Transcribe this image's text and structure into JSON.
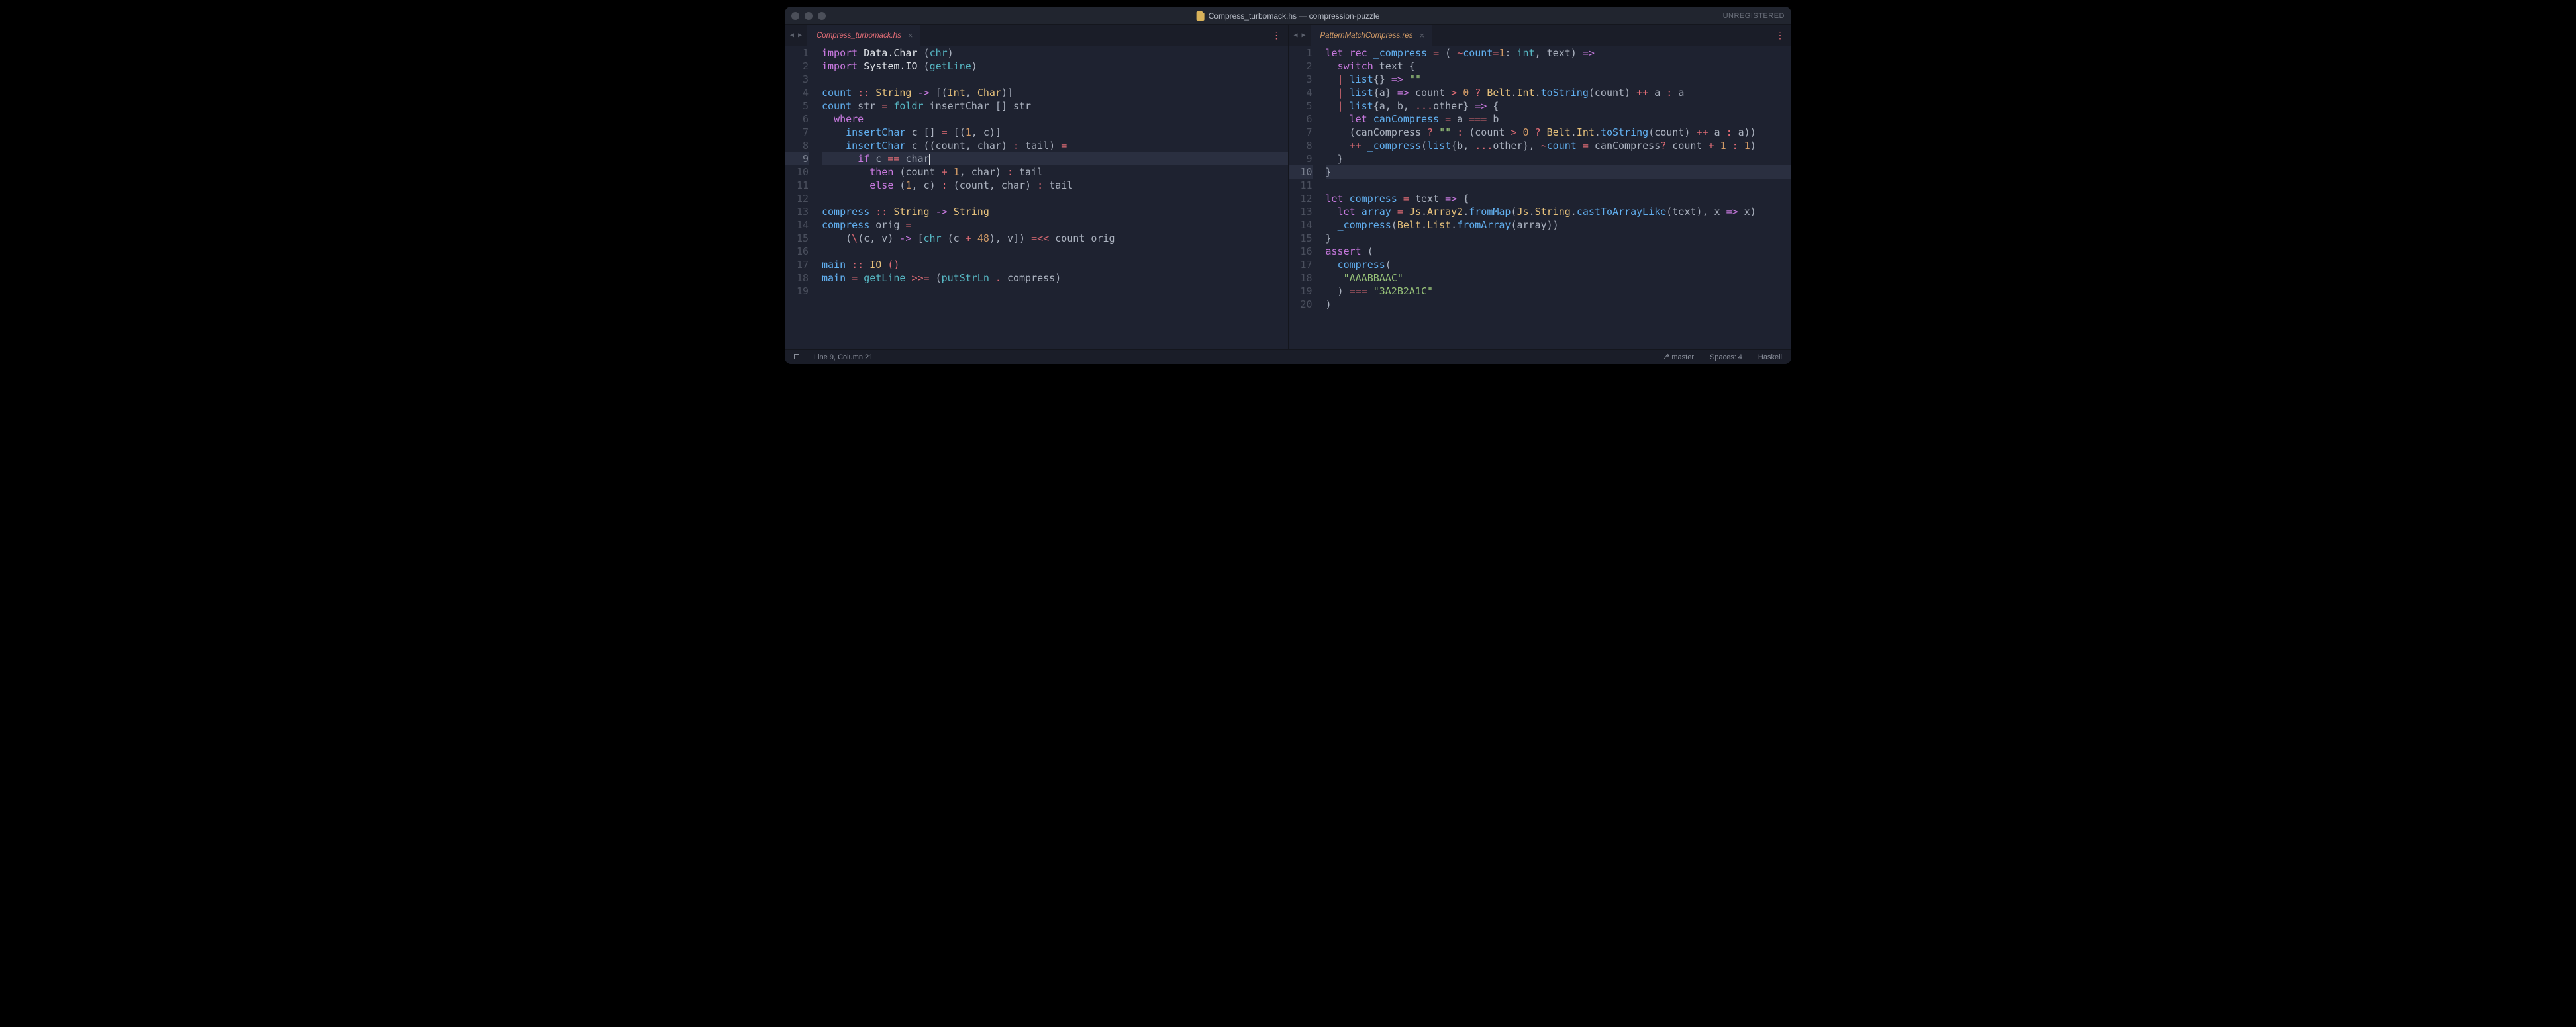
{
  "title": "Compress_turbomack.hs — compression-puzzle",
  "unregistered": "UNREGISTERED",
  "status": {
    "cursor": "Line 9, Column 21",
    "branch": "master",
    "spaces": "Spaces: 4",
    "syntax": "Haskell"
  },
  "left": {
    "tab": "Compress_turbomack.hs",
    "highlight_line": 9,
    "lines": [
      [
        {
          "c": "kw",
          "t": "import"
        },
        {
          "c": "pn",
          "t": " "
        },
        {
          "c": "wht",
          "t": "Data.Char"
        },
        {
          "c": "pn",
          "t": " ("
        },
        {
          "c": "ty",
          "t": "chr"
        },
        {
          "c": "pn",
          "t": ")"
        }
      ],
      [
        {
          "c": "kw",
          "t": "import"
        },
        {
          "c": "pn",
          "t": " "
        },
        {
          "c": "wht",
          "t": "System.IO"
        },
        {
          "c": "pn",
          "t": " ("
        },
        {
          "c": "ty",
          "t": "getLine"
        },
        {
          "c": "pn",
          "t": ")"
        }
      ],
      [],
      [
        {
          "c": "fn",
          "t": "count"
        },
        {
          "c": "pn",
          "t": " "
        },
        {
          "c": "red",
          "t": "::"
        },
        {
          "c": "pn",
          "t": " "
        },
        {
          "c": "id",
          "t": "String"
        },
        {
          "c": "pn",
          "t": " "
        },
        {
          "c": "kw",
          "t": "->"
        },
        {
          "c": "pn",
          "t": " ["
        },
        {
          "c": "pn",
          "t": "("
        },
        {
          "c": "id",
          "t": "Int"
        },
        {
          "c": "pn",
          "t": ", "
        },
        {
          "c": "id",
          "t": "Char"
        },
        {
          "c": "pn",
          "t": ")]"
        }
      ],
      [
        {
          "c": "fn",
          "t": "count"
        },
        {
          "c": "pn",
          "t": " str "
        },
        {
          "c": "red",
          "t": "="
        },
        {
          "c": "pn",
          "t": " "
        },
        {
          "c": "ty",
          "t": "foldr"
        },
        {
          "c": "pn",
          "t": " insertChar "
        },
        {
          "c": "pn",
          "t": "[]"
        },
        {
          "c": "pn",
          "t": " str"
        }
      ],
      [
        {
          "c": "pn",
          "t": "  "
        },
        {
          "c": "kw",
          "t": "where"
        }
      ],
      [
        {
          "c": "pn",
          "t": "    "
        },
        {
          "c": "fn",
          "t": "insertChar"
        },
        {
          "c": "pn",
          "t": " c "
        },
        {
          "c": "pn",
          "t": "[]"
        },
        {
          "c": "pn",
          "t": " "
        },
        {
          "c": "red",
          "t": "="
        },
        {
          "c": "pn",
          "t": " [("
        },
        {
          "c": "num",
          "t": "1"
        },
        {
          "c": "pn",
          "t": ", c)]"
        }
      ],
      [
        {
          "c": "pn",
          "t": "    "
        },
        {
          "c": "fn",
          "t": "insertChar"
        },
        {
          "c": "pn",
          "t": " c ((count, char) "
        },
        {
          "c": "red",
          "t": ":"
        },
        {
          "c": "pn",
          "t": " tail) "
        },
        {
          "c": "red",
          "t": "="
        }
      ],
      [
        {
          "c": "pn",
          "t": "      "
        },
        {
          "c": "kw",
          "t": "if"
        },
        {
          "c": "pn",
          "t": " c "
        },
        {
          "c": "red",
          "t": "=="
        },
        {
          "c": "pn",
          "t": " char"
        }
      ],
      [
        {
          "c": "pn",
          "t": "        "
        },
        {
          "c": "kw",
          "t": "then"
        },
        {
          "c": "pn",
          "t": " (count "
        },
        {
          "c": "red",
          "t": "+"
        },
        {
          "c": "pn",
          "t": " "
        },
        {
          "c": "num",
          "t": "1"
        },
        {
          "c": "pn",
          "t": ", char) "
        },
        {
          "c": "red",
          "t": ":"
        },
        {
          "c": "pn",
          "t": " tail"
        }
      ],
      [
        {
          "c": "pn",
          "t": "        "
        },
        {
          "c": "kw",
          "t": "else"
        },
        {
          "c": "pn",
          "t": " ("
        },
        {
          "c": "num",
          "t": "1"
        },
        {
          "c": "pn",
          "t": ", c) "
        },
        {
          "c": "red",
          "t": ":"
        },
        {
          "c": "pn",
          "t": " (count, char) "
        },
        {
          "c": "red",
          "t": ":"
        },
        {
          "c": "pn",
          "t": " tail"
        }
      ],
      [],
      [
        {
          "c": "fn",
          "t": "compress"
        },
        {
          "c": "pn",
          "t": " "
        },
        {
          "c": "red",
          "t": "::"
        },
        {
          "c": "pn",
          "t": " "
        },
        {
          "c": "id",
          "t": "String"
        },
        {
          "c": "pn",
          "t": " "
        },
        {
          "c": "kw",
          "t": "->"
        },
        {
          "c": "pn",
          "t": " "
        },
        {
          "c": "id",
          "t": "String"
        }
      ],
      [
        {
          "c": "fn",
          "t": "compress"
        },
        {
          "c": "pn",
          "t": " orig "
        },
        {
          "c": "red",
          "t": "="
        }
      ],
      [
        {
          "c": "pn",
          "t": "    ("
        },
        {
          "c": "red",
          "t": "\\"
        },
        {
          "c": "pn",
          "t": "(c, v) "
        },
        {
          "c": "kw",
          "t": "->"
        },
        {
          "c": "pn",
          "t": " ["
        },
        {
          "c": "ty",
          "t": "chr"
        },
        {
          "c": "pn",
          "t": " (c "
        },
        {
          "c": "red",
          "t": "+"
        },
        {
          "c": "pn",
          "t": " "
        },
        {
          "c": "num",
          "t": "48"
        },
        {
          "c": "pn",
          "t": "), v]) "
        },
        {
          "c": "red",
          "t": "=<<"
        },
        {
          "c": "pn",
          "t": " count orig"
        }
      ],
      [],
      [
        {
          "c": "fn",
          "t": "main"
        },
        {
          "c": "pn",
          "t": " "
        },
        {
          "c": "red",
          "t": "::"
        },
        {
          "c": "pn",
          "t": " "
        },
        {
          "c": "id",
          "t": "IO"
        },
        {
          "c": "pn",
          "t": " "
        },
        {
          "c": "red",
          "t": "()"
        }
      ],
      [
        {
          "c": "fn",
          "t": "main"
        },
        {
          "c": "pn",
          "t": " "
        },
        {
          "c": "red",
          "t": "="
        },
        {
          "c": "pn",
          "t": " "
        },
        {
          "c": "ty",
          "t": "getLine"
        },
        {
          "c": "pn",
          "t": " "
        },
        {
          "c": "red",
          "t": ">>="
        },
        {
          "c": "pn",
          "t": " ("
        },
        {
          "c": "ty",
          "t": "putStrLn"
        },
        {
          "c": "pn",
          "t": " "
        },
        {
          "c": "red",
          "t": "."
        },
        {
          "c": "pn",
          "t": " compress)"
        }
      ],
      []
    ]
  },
  "right": {
    "tab": "PatternMatchCompress.res",
    "highlight_line": 10,
    "lines": [
      [
        {
          "c": "kw",
          "t": "let"
        },
        {
          "c": "pn",
          "t": " "
        },
        {
          "c": "kw",
          "t": "rec"
        },
        {
          "c": "pn",
          "t": " "
        },
        {
          "c": "fn",
          "t": "_compress"
        },
        {
          "c": "pn",
          "t": " "
        },
        {
          "c": "red",
          "t": "="
        },
        {
          "c": "pn",
          "t": " ( "
        },
        {
          "c": "red",
          "t": "~"
        },
        {
          "c": "fn",
          "t": "count"
        },
        {
          "c": "red",
          "t": "="
        },
        {
          "c": "num",
          "t": "1"
        },
        {
          "c": "pn",
          "t": ": "
        },
        {
          "c": "ty",
          "t": "int"
        },
        {
          "c": "pn",
          "t": ", text) "
        },
        {
          "c": "kw",
          "t": "=>"
        }
      ],
      [
        {
          "c": "pn",
          "t": "  "
        },
        {
          "c": "kw",
          "t": "switch"
        },
        {
          "c": "pn",
          "t": " text {"
        }
      ],
      [
        {
          "c": "pn",
          "t": "  "
        },
        {
          "c": "red",
          "t": "|"
        },
        {
          "c": "pn",
          "t": " "
        },
        {
          "c": "fn",
          "t": "list"
        },
        {
          "c": "pn",
          "t": "{} "
        },
        {
          "c": "kw",
          "t": "=>"
        },
        {
          "c": "pn",
          "t": " "
        },
        {
          "c": "str",
          "t": "\"\""
        }
      ],
      [
        {
          "c": "pn",
          "t": "  "
        },
        {
          "c": "red",
          "t": "|"
        },
        {
          "c": "pn",
          "t": " "
        },
        {
          "c": "fn",
          "t": "list"
        },
        {
          "c": "pn",
          "t": "{a} "
        },
        {
          "c": "kw",
          "t": "=>"
        },
        {
          "c": "pn",
          "t": " count "
        },
        {
          "c": "red",
          "t": ">"
        },
        {
          "c": "pn",
          "t": " "
        },
        {
          "c": "num",
          "t": "0"
        },
        {
          "c": "pn",
          "t": " "
        },
        {
          "c": "red",
          "t": "?"
        },
        {
          "c": "pn",
          "t": " "
        },
        {
          "c": "id",
          "t": "Belt"
        },
        {
          "c": "pn",
          "t": "."
        },
        {
          "c": "id",
          "t": "Int"
        },
        {
          "c": "pn",
          "t": "."
        },
        {
          "c": "fn",
          "t": "toString"
        },
        {
          "c": "pn",
          "t": "(count) "
        },
        {
          "c": "red",
          "t": "++"
        },
        {
          "c": "pn",
          "t": " a "
        },
        {
          "c": "red",
          "t": ":"
        },
        {
          "c": "pn",
          "t": " a"
        }
      ],
      [
        {
          "c": "pn",
          "t": "  "
        },
        {
          "c": "red",
          "t": "|"
        },
        {
          "c": "pn",
          "t": " "
        },
        {
          "c": "fn",
          "t": "list"
        },
        {
          "c": "pn",
          "t": "{a, b, "
        },
        {
          "c": "red",
          "t": "..."
        },
        {
          "c": "pn",
          "t": "other} "
        },
        {
          "c": "kw",
          "t": "=>"
        },
        {
          "c": "pn",
          "t": " {"
        }
      ],
      [
        {
          "c": "pn",
          "t": "    "
        },
        {
          "c": "kw",
          "t": "let"
        },
        {
          "c": "pn",
          "t": " "
        },
        {
          "c": "fn",
          "t": "canCompress"
        },
        {
          "c": "pn",
          "t": " "
        },
        {
          "c": "red",
          "t": "="
        },
        {
          "c": "pn",
          "t": " a "
        },
        {
          "c": "red",
          "t": "==="
        },
        {
          "c": "pn",
          "t": " b"
        }
      ],
      [
        {
          "c": "pn",
          "t": "    (canCompress "
        },
        {
          "c": "red",
          "t": "?"
        },
        {
          "c": "pn",
          "t": " "
        },
        {
          "c": "str",
          "t": "\"\""
        },
        {
          "c": "pn",
          "t": " "
        },
        {
          "c": "red",
          "t": ":"
        },
        {
          "c": "pn",
          "t": " (count "
        },
        {
          "c": "red",
          "t": ">"
        },
        {
          "c": "pn",
          "t": " "
        },
        {
          "c": "num",
          "t": "0"
        },
        {
          "c": "pn",
          "t": " "
        },
        {
          "c": "red",
          "t": "?"
        },
        {
          "c": "pn",
          "t": " "
        },
        {
          "c": "id",
          "t": "Belt"
        },
        {
          "c": "pn",
          "t": "."
        },
        {
          "c": "id",
          "t": "Int"
        },
        {
          "c": "pn",
          "t": "."
        },
        {
          "c": "fn",
          "t": "toString"
        },
        {
          "c": "pn",
          "t": "(count) "
        },
        {
          "c": "red",
          "t": "++"
        },
        {
          "c": "pn",
          "t": " a "
        },
        {
          "c": "red",
          "t": ":"
        },
        {
          "c": "pn",
          "t": " a))"
        }
      ],
      [
        {
          "c": "pn",
          "t": "    "
        },
        {
          "c": "red",
          "t": "++"
        },
        {
          "c": "pn",
          "t": " "
        },
        {
          "c": "fn",
          "t": "_compress"
        },
        {
          "c": "pn",
          "t": "("
        },
        {
          "c": "fn",
          "t": "list"
        },
        {
          "c": "pn",
          "t": "{b, "
        },
        {
          "c": "red",
          "t": "..."
        },
        {
          "c": "pn",
          "t": "other}, "
        },
        {
          "c": "red",
          "t": "~"
        },
        {
          "c": "fn",
          "t": "count"
        },
        {
          "c": "pn",
          "t": " "
        },
        {
          "c": "red",
          "t": "="
        },
        {
          "c": "pn",
          "t": " canCompress"
        },
        {
          "c": "red",
          "t": "?"
        },
        {
          "c": "pn",
          "t": " count "
        },
        {
          "c": "red",
          "t": "+"
        },
        {
          "c": "pn",
          "t": " "
        },
        {
          "c": "num",
          "t": "1"
        },
        {
          "c": "pn",
          "t": " "
        },
        {
          "c": "red",
          "t": ":"
        },
        {
          "c": "pn",
          "t": " "
        },
        {
          "c": "num",
          "t": "1"
        },
        {
          "c": "pn",
          "t": ")"
        }
      ],
      [
        {
          "c": "pn",
          "t": "  }"
        }
      ],
      [
        {
          "c": "pn",
          "t": "}"
        }
      ],
      [],
      [
        {
          "c": "kw",
          "t": "let"
        },
        {
          "c": "pn",
          "t": " "
        },
        {
          "c": "fn",
          "t": "compress"
        },
        {
          "c": "pn",
          "t": " "
        },
        {
          "c": "red",
          "t": "="
        },
        {
          "c": "pn",
          "t": " text "
        },
        {
          "c": "kw",
          "t": "=>"
        },
        {
          "c": "pn",
          "t": " {"
        }
      ],
      [
        {
          "c": "pn",
          "t": "  "
        },
        {
          "c": "kw",
          "t": "let"
        },
        {
          "c": "pn",
          "t": " "
        },
        {
          "c": "fn",
          "t": "array"
        },
        {
          "c": "pn",
          "t": " "
        },
        {
          "c": "red",
          "t": "="
        },
        {
          "c": "pn",
          "t": " "
        },
        {
          "c": "id",
          "t": "Js"
        },
        {
          "c": "pn",
          "t": "."
        },
        {
          "c": "id",
          "t": "Array2"
        },
        {
          "c": "pn",
          "t": "."
        },
        {
          "c": "fn",
          "t": "fromMap"
        },
        {
          "c": "pn",
          "t": "("
        },
        {
          "c": "id",
          "t": "Js"
        },
        {
          "c": "pn",
          "t": "."
        },
        {
          "c": "id",
          "t": "String"
        },
        {
          "c": "pn",
          "t": "."
        },
        {
          "c": "fn",
          "t": "castToArrayLike"
        },
        {
          "c": "pn",
          "t": "(text), x "
        },
        {
          "c": "kw",
          "t": "=>"
        },
        {
          "c": "pn",
          "t": " x)"
        }
      ],
      [
        {
          "c": "pn",
          "t": "  "
        },
        {
          "c": "fn",
          "t": "_compress"
        },
        {
          "c": "pn",
          "t": "("
        },
        {
          "c": "id",
          "t": "Belt"
        },
        {
          "c": "pn",
          "t": "."
        },
        {
          "c": "id",
          "t": "List"
        },
        {
          "c": "pn",
          "t": "."
        },
        {
          "c": "fn",
          "t": "fromArray"
        },
        {
          "c": "pn",
          "t": "(array))"
        }
      ],
      [
        {
          "c": "pn",
          "t": "}"
        }
      ],
      [
        {
          "c": "kw",
          "t": "assert"
        },
        {
          "c": "pn",
          "t": " ("
        }
      ],
      [
        {
          "c": "pn",
          "t": "  "
        },
        {
          "c": "fn",
          "t": "compress"
        },
        {
          "c": "pn",
          "t": "("
        }
      ],
      [
        {
          "c": "pn",
          "t": "   "
        },
        {
          "c": "str",
          "t": "\"AAABBAAC\""
        }
      ],
      [
        {
          "c": "pn",
          "t": "  ) "
        },
        {
          "c": "red",
          "t": "==="
        },
        {
          "c": "pn",
          "t": " "
        },
        {
          "c": "str",
          "t": "\"3A2B2A1C\""
        }
      ],
      [
        {
          "c": "pn",
          "t": ")"
        }
      ]
    ]
  }
}
